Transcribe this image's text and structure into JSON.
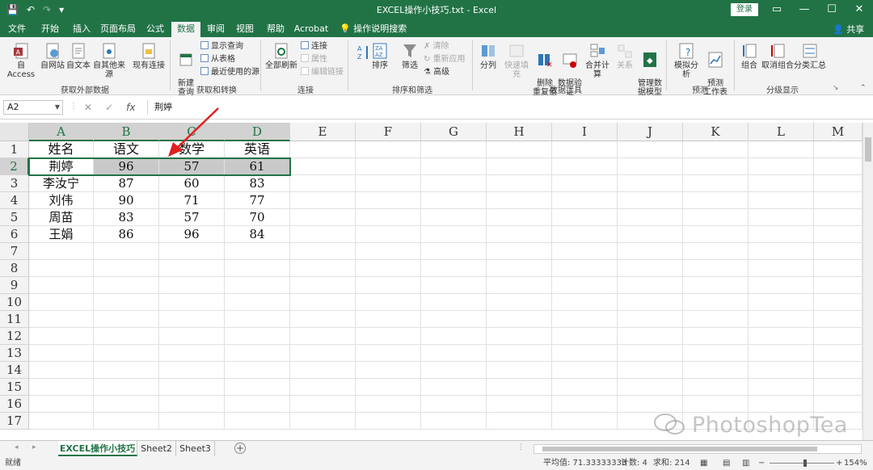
{
  "window": {
    "title": "EXCEL操作小技巧.txt  -  Excel",
    "login_label": "登录",
    "controls": [
      "▭",
      "—",
      "☐",
      "✕"
    ]
  },
  "menu": {
    "items": [
      "文件",
      "开始",
      "插入",
      "页面布局",
      "公式",
      "数据",
      "审阅",
      "视图",
      "帮助",
      "Acrobat"
    ],
    "active": "数据",
    "search": "操作说明搜索",
    "share": "共享"
  },
  "ribbon": {
    "get_external": {
      "label": "获取外部数据",
      "buttons": [
        "自 Access",
        "自网站",
        "自文本",
        "自其他来源",
        "现有连接"
      ]
    },
    "get_transform": {
      "label": "获取和转换",
      "new_query": "新建\n查询",
      "small": [
        "显示查询",
        "从表格",
        "最近使用的源"
      ]
    },
    "connections": {
      "label": "连接",
      "refresh_all": "全部刷新",
      "small": [
        "连接",
        "属性",
        "编辑链接"
      ]
    },
    "sort_filter": {
      "label": "排序和筛选",
      "sort": "排序",
      "filter": "筛选",
      "small": [
        "清除",
        "重新应用",
        "高级"
      ]
    },
    "data_tools": {
      "label": "数据工具",
      "buttons": [
        "分列",
        "快速填充",
        "删除\n重复值",
        "数据验\n证",
        "合并计算",
        "关系",
        "管理数\n据模型"
      ]
    },
    "forecast": {
      "label": "预测",
      "buttons": [
        "模拟分析",
        "预测\n工作表"
      ]
    },
    "outline": {
      "label": "分级显示",
      "buttons": [
        "组合",
        "取消组合",
        "分类汇总"
      ]
    }
  },
  "formula_bar": {
    "name_box": "A2",
    "fx": "fx",
    "content": "荆婷"
  },
  "sheet": {
    "columns": [
      "A",
      "B",
      "C",
      "D",
      "E",
      "F",
      "G",
      "H",
      "I",
      "J",
      "K",
      "L",
      "M"
    ],
    "rows": [
      "1",
      "2",
      "3",
      "4",
      "5",
      "6",
      "7",
      "8",
      "9",
      "10",
      "11",
      "12",
      "13",
      "14",
      "15",
      "16",
      "17"
    ],
    "header_row": [
      "姓名",
      "语文",
      "数学",
      "英语"
    ],
    "data": [
      [
        "荆婷",
        "96",
        "57",
        "61"
      ],
      [
        "李汝宁",
        "87",
        "60",
        "83"
      ],
      [
        "刘伟",
        "90",
        "71",
        "77"
      ],
      [
        "周苗",
        "83",
        "57",
        "70"
      ],
      [
        "王娟",
        "86",
        "96",
        "84"
      ]
    ]
  },
  "tabs": {
    "sheets": [
      "EXCEL操作小技巧",
      "Sheet2",
      "Sheet3"
    ],
    "active": "EXCEL操作小技巧",
    "add": "+"
  },
  "status": {
    "ready": "就绪",
    "average": "平均值: 71.33333333",
    "count": "计数: 4",
    "sum": "求和: 214",
    "zoom": "154%"
  },
  "watermark": "PhotoshopTea",
  "colors": {
    "accent": "#217346",
    "selection": "#c9c9c9",
    "arrow": "#e02020"
  }
}
